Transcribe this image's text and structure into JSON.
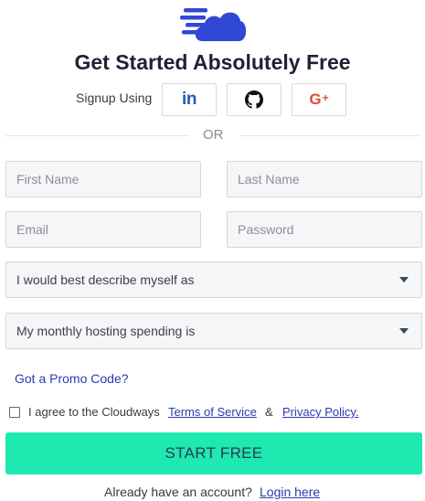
{
  "brand": {
    "logo_icon": "cloud-speed-logo-icon",
    "accent_color": "#3048d4"
  },
  "heading": {
    "title": "Get Started Absolutely Free"
  },
  "signup": {
    "label": "Signup Using",
    "providers": [
      {
        "name": "linkedin",
        "label": "in",
        "icon": "linkedin-icon",
        "color": "#1f5eb5"
      },
      {
        "name": "github",
        "icon": "github-icon",
        "color": "#111111"
      },
      {
        "name": "google-plus",
        "label": "G",
        "plus": "+",
        "icon": "google-plus-icon",
        "color": "#dd4b39"
      }
    ]
  },
  "divider": {
    "text": "OR"
  },
  "form": {
    "first_name_placeholder": "First Name",
    "last_name_placeholder": "Last Name",
    "email_placeholder": "Email",
    "password_placeholder": "Password",
    "describe_select": "I would best describe myself as",
    "spending_select": "My monthly hosting spending is",
    "promo_link": "Got a Promo Code?",
    "agree_text": "I agree to the Cloudways",
    "terms_link": "Terms of Service",
    "ampersand": "&",
    "privacy_link": "Privacy Policy.",
    "submit_label": "START FREE",
    "submit_color": "#1de9b0"
  },
  "footer": {
    "already_text": "Already have an account?",
    "login_link": "Login here"
  }
}
